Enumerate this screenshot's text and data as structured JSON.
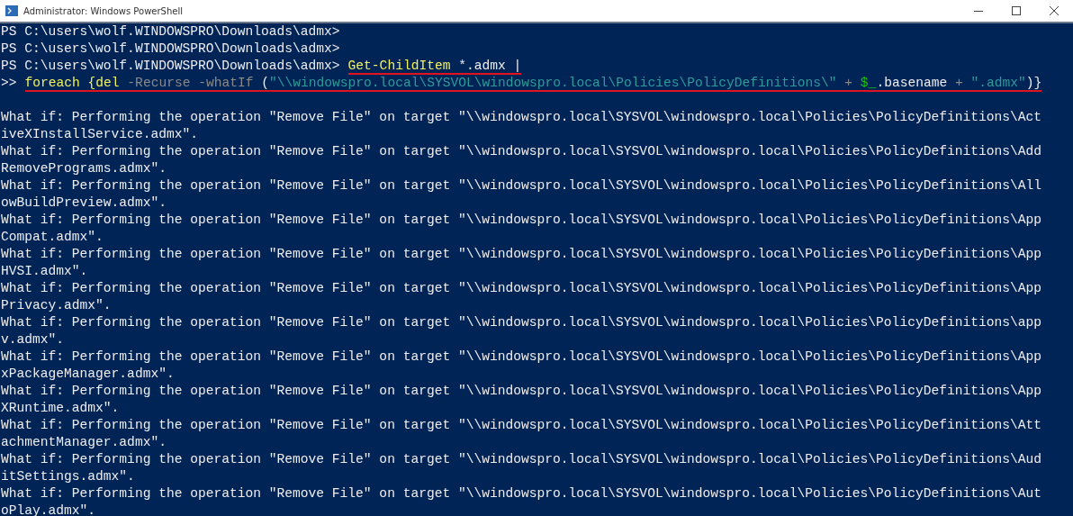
{
  "window": {
    "title": "Administrator: Windows PowerShell"
  },
  "console": {
    "lines": [
      {
        "kind": "prompt",
        "prompt": "PS C:\\users\\wolf.WINDOWSPRO\\Downloads\\admx>"
      },
      {
        "kind": "prompt",
        "prompt": "PS C:\\users\\wolf.WINDOWSPRO\\Downloads\\admx>"
      },
      {
        "kind": "prompt",
        "prompt": "PS C:\\users\\wolf.WINDOWSPRO\\Downloads\\admx>",
        "underlined": true,
        "segments": [
          {
            "kind": "command",
            "text": "Get-ChildItem"
          },
          {
            "kind": "plain",
            "text": " *.admx |"
          }
        ]
      },
      {
        "kind": "prompt",
        "prompt": ">>",
        "underlined": true,
        "segments": [
          {
            "kind": "command",
            "text": "foreach {del"
          },
          {
            "kind": "param",
            "text": " -Recurse -whatIf "
          },
          {
            "kind": "plain",
            "text": "("
          },
          {
            "kind": "string",
            "text": "\"\\\\windowspro.local\\SYSVOL\\windowspro.local\\Policies\\PolicyDefinitions\\\""
          },
          {
            "kind": "param",
            "text": " + "
          },
          {
            "kind": "variable",
            "text": "$_"
          },
          {
            "kind": "plain",
            "text": ".basename"
          },
          {
            "kind": "param",
            "text": " + "
          },
          {
            "kind": "string",
            "text": "\".admx\""
          },
          {
            "kind": "plain",
            "text": ")}"
          }
        ]
      },
      {
        "kind": "blank"
      },
      {
        "kind": "output",
        "text": "What if: Performing the operation \"Remove File\" on target \"\\\\windowspro.local\\SYSVOL\\windowspro.local\\Policies\\PolicyDefinitions\\Act"
      },
      {
        "kind": "output",
        "text": "iveXInstallService.admx\"."
      },
      {
        "kind": "output",
        "text": "What if: Performing the operation \"Remove File\" on target \"\\\\windowspro.local\\SYSVOL\\windowspro.local\\Policies\\PolicyDefinitions\\Add"
      },
      {
        "kind": "output",
        "text": "RemovePrograms.admx\"."
      },
      {
        "kind": "output",
        "text": "What if: Performing the operation \"Remove File\" on target \"\\\\windowspro.local\\SYSVOL\\windowspro.local\\Policies\\PolicyDefinitions\\All"
      },
      {
        "kind": "output",
        "text": "owBuildPreview.admx\"."
      },
      {
        "kind": "output",
        "text": "What if: Performing the operation \"Remove File\" on target \"\\\\windowspro.local\\SYSVOL\\windowspro.local\\Policies\\PolicyDefinitions\\App"
      },
      {
        "kind": "output",
        "text": "Compat.admx\"."
      },
      {
        "kind": "output",
        "text": "What if: Performing the operation \"Remove File\" on target \"\\\\windowspro.local\\SYSVOL\\windowspro.local\\Policies\\PolicyDefinitions\\App"
      },
      {
        "kind": "output",
        "text": "HVSI.admx\"."
      },
      {
        "kind": "output",
        "text": "What if: Performing the operation \"Remove File\" on target \"\\\\windowspro.local\\SYSVOL\\windowspro.local\\Policies\\PolicyDefinitions\\App"
      },
      {
        "kind": "output",
        "text": "Privacy.admx\"."
      },
      {
        "kind": "output",
        "text": "What if: Performing the operation \"Remove File\" on target \"\\\\windowspro.local\\SYSVOL\\windowspro.local\\Policies\\PolicyDefinitions\\app"
      },
      {
        "kind": "output",
        "text": "v.admx\"."
      },
      {
        "kind": "output",
        "text": "What if: Performing the operation \"Remove File\" on target \"\\\\windowspro.local\\SYSVOL\\windowspro.local\\Policies\\PolicyDefinitions\\App"
      },
      {
        "kind": "output",
        "text": "xPackageManager.admx\"."
      },
      {
        "kind": "output",
        "text": "What if: Performing the operation \"Remove File\" on target \"\\\\windowspro.local\\SYSVOL\\windowspro.local\\Policies\\PolicyDefinitions\\App"
      },
      {
        "kind": "output",
        "text": "XRuntime.admx\"."
      },
      {
        "kind": "output",
        "text": "What if: Performing the operation \"Remove File\" on target \"\\\\windowspro.local\\SYSVOL\\windowspro.local\\Policies\\PolicyDefinitions\\Att"
      },
      {
        "kind": "output",
        "text": "achmentManager.admx\"."
      },
      {
        "kind": "output",
        "text": "What if: Performing the operation \"Remove File\" on target \"\\\\windowspro.local\\SYSVOL\\windowspro.local\\Policies\\PolicyDefinitions\\Aud"
      },
      {
        "kind": "output",
        "text": "itSettings.admx\"."
      },
      {
        "kind": "output",
        "text": "What if: Performing the operation \"Remove File\" on target \"\\\\windowspro.local\\SYSVOL\\windowspro.local\\Policies\\PolicyDefinitions\\Aut"
      },
      {
        "kind": "output",
        "text": "oPlay.admx\"."
      }
    ]
  }
}
